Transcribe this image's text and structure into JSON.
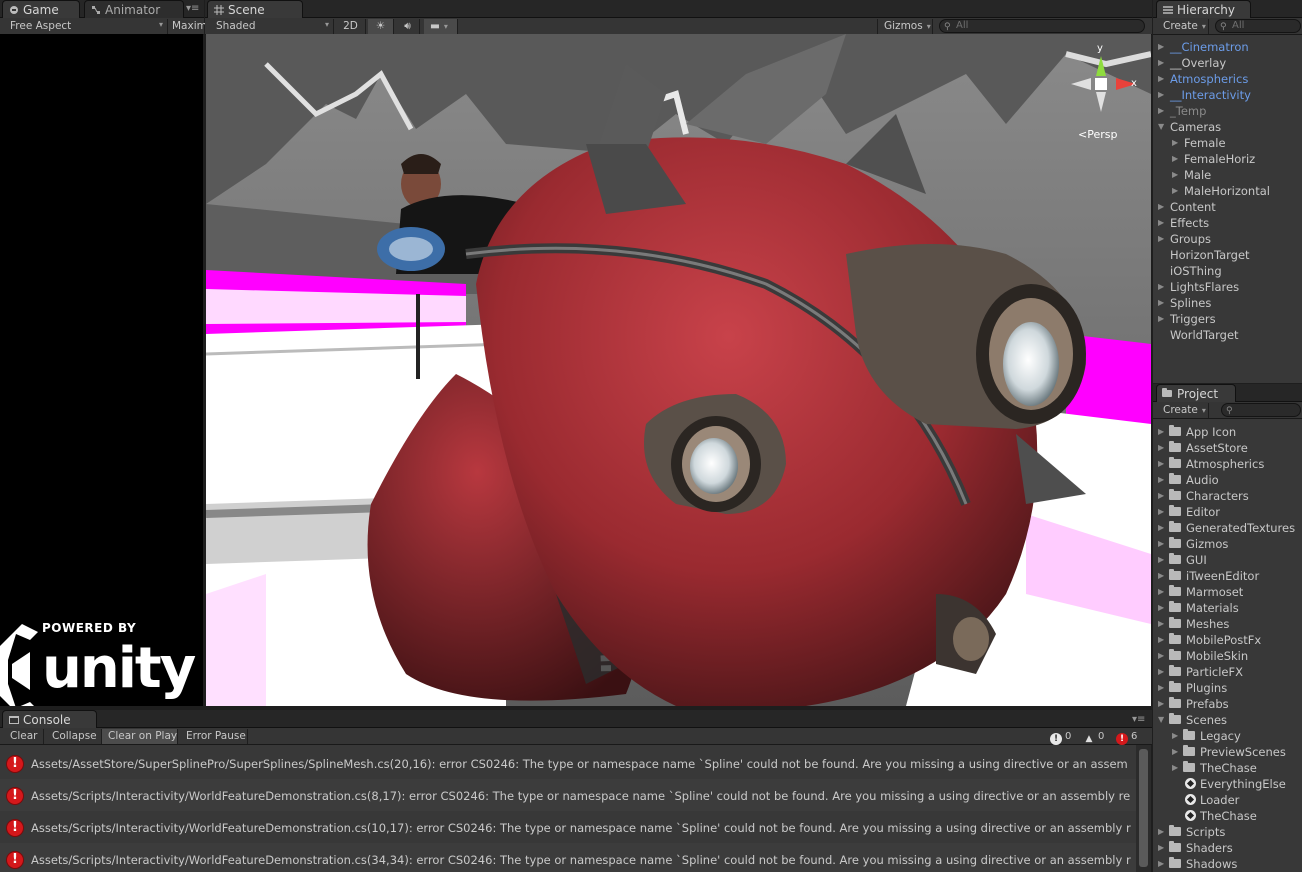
{
  "game_panel": {
    "tabs": [
      {
        "label": "Game"
      },
      {
        "label": "Animator"
      }
    ],
    "aspect_select": "Free Aspect",
    "maximize_label": "Maxim",
    "splash": {
      "powered_by": "POWERED BY",
      "logo_text": "unity"
    }
  },
  "scene_panel": {
    "tab_label": "Scene",
    "render_mode": "Shaded",
    "toggle_2d": "2D",
    "gizmos_label": "Gizmos",
    "search_placeholder": "All",
    "gizmo_axes": {
      "y": "y",
      "x": "x"
    },
    "projection_label": "Persp"
  },
  "hierarchy_panel": {
    "tab_label": "Hierarchy",
    "create_label": "Create",
    "search_placeholder": "All",
    "items": [
      {
        "label": "__Cinematron",
        "color": "blue"
      },
      {
        "label": "__Overlay",
        "color": "normal"
      },
      {
        "label": "Atmospherics",
        "color": "blue"
      },
      {
        "label": "__Interactivity",
        "color": "blue"
      },
      {
        "label": "_Temp",
        "color": "gray"
      },
      {
        "label": "Cameras",
        "color": "normal"
      },
      {
        "label": "Female",
        "color": "normal"
      },
      {
        "label": "FemaleHoriz",
        "color": "normal"
      },
      {
        "label": "Male",
        "color": "normal"
      },
      {
        "label": "MaleHorizontal",
        "color": "normal"
      },
      {
        "label": "Content",
        "color": "normal"
      },
      {
        "label": "Effects",
        "color": "normal"
      },
      {
        "label": "Groups",
        "color": "normal"
      },
      {
        "label": "HorizonTarget",
        "color": "normal"
      },
      {
        "label": "iOSThing",
        "color": "normal"
      },
      {
        "label": "LightsFlares",
        "color": "normal"
      },
      {
        "label": "Splines",
        "color": "normal"
      },
      {
        "label": "Triggers",
        "color": "normal"
      },
      {
        "label": "WorldTarget",
        "color": "normal"
      }
    ]
  },
  "project_panel": {
    "tab_label": "Project",
    "create_label": "Create",
    "items": [
      {
        "label": "App Icon"
      },
      {
        "label": "AssetStore"
      },
      {
        "label": "Atmospherics"
      },
      {
        "label": "Audio"
      },
      {
        "label": "Characters"
      },
      {
        "label": "Editor"
      },
      {
        "label": "GeneratedTextures"
      },
      {
        "label": "Gizmos"
      },
      {
        "label": "GUI"
      },
      {
        "label": "iTweenEditor"
      },
      {
        "label": "Marmoset"
      },
      {
        "label": "Materials"
      },
      {
        "label": "Meshes"
      },
      {
        "label": "MobilePostFx"
      },
      {
        "label": "MobileSkin"
      },
      {
        "label": "ParticleFX"
      },
      {
        "label": "Plugins"
      },
      {
        "label": "Prefabs"
      },
      {
        "label": "Scenes"
      },
      {
        "label": "Legacy"
      },
      {
        "label": "PreviewScenes"
      },
      {
        "label": "TheChase"
      },
      {
        "label": "EverythingElse"
      },
      {
        "label": "Loader"
      },
      {
        "label": "TheChase"
      },
      {
        "label": "Scripts"
      },
      {
        "label": "Shaders"
      },
      {
        "label": "Shadows"
      }
    ]
  },
  "console_panel": {
    "tab_label": "Console",
    "buttons": {
      "clear": "Clear",
      "collapse": "Collapse",
      "clear_on_play": "Clear on Play",
      "error_pause": "Error Pause"
    },
    "counts": {
      "info": "0",
      "warnings": "0",
      "errors": "6"
    },
    "messages": [
      "Assets/AssetStore/SuperSplinePro/SuperSplines/SplineMesh.cs(20,16): error CS0246: The type or namespace name `Spline' could not be found. Are you missing a using directive or an assem",
      "Assets/Scripts/Interactivity/WorldFeatureDemonstration.cs(8,17): error CS0246: The type or namespace name `Spline' could not be found. Are you missing a using directive or an assembly re",
      "Assets/Scripts/Interactivity/WorldFeatureDemonstration.cs(10,17): error CS0246: The type or namespace name `Spline' could not be found. Are you missing a using directive or an assembly r",
      "Assets/Scripts/Interactivity/WorldFeatureDemonstration.cs(34,34): error CS0246: The type or namespace name `Spline' could not be found. Are you missing a using directive or an assembly r"
    ]
  },
  "colors": {
    "accent_blue": "#6c9ce8",
    "error_red": "#d4181b",
    "magenta_floor": "#ff00ff"
  }
}
